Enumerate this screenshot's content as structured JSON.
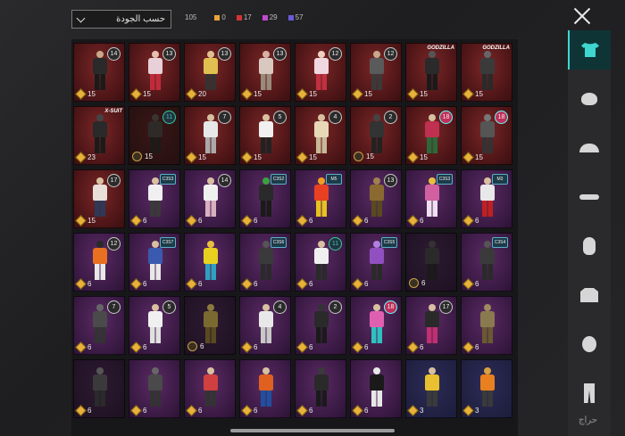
{
  "topbar": {
    "sort_label": "حسب الجودة",
    "total_count": "105",
    "rarity_counts": [
      {
        "color": "#e8a33a",
        "value": "0"
      },
      {
        "color": "#d23434",
        "value": "17"
      },
      {
        "color": "#c04ad0",
        "value": "29"
      },
      {
        "color": "#6a5ad8",
        "value": "57"
      }
    ]
  },
  "items": [
    {
      "bg": "red",
      "badge": "14",
      "badge_type": "circle",
      "qty_icon": "diamond",
      "qty": "15",
      "torso": "#2a2a2a",
      "legs": "#1a1a1a",
      "head": "#c9a88a"
    },
    {
      "bg": "red",
      "badge": "13",
      "badge_type": "circle",
      "qty_icon": "diamond",
      "qty": "15",
      "torso": "#e8d0d8",
      "legs": "#c02b3c",
      "head": "#e8c0b0"
    },
    {
      "bg": "red",
      "badge": "13",
      "badge_type": "circle",
      "qty_icon": "diamond",
      "qty": "20",
      "torso": "#e0c050",
      "legs": "#333",
      "head": "#e0c090"
    },
    {
      "bg": "red",
      "badge": "13",
      "badge_type": "circle",
      "qty_icon": "diamond",
      "qty": "15",
      "torso": "#d8c8c0",
      "legs": "#9a8a7a",
      "head": "#d8b0a0"
    },
    {
      "bg": "red",
      "badge": "12",
      "badge_type": "circle",
      "qty_icon": "diamond",
      "qty": "15",
      "torso": "#f0d8e0",
      "legs": "#c03040",
      "head": "#f0d0c0"
    },
    {
      "bg": "red",
      "badge": "12",
      "badge_type": "circle",
      "qty_icon": "diamond",
      "qty": "15",
      "torso": "#5a5a5a",
      "legs": "#3a3a3a",
      "head": "#c9a88a"
    },
    {
      "bg": "red",
      "banner": "GODZILLA",
      "badge_type": "banner",
      "qty_icon": "diamond",
      "qty": "15",
      "torso": "#2a2a2a",
      "legs": "#1a1a1a",
      "head": "#555"
    },
    {
      "bg": "red",
      "banner": "GODZILLA",
      "badge_type": "banner",
      "qty_icon": "diamond",
      "qty": "15",
      "torso": "#3a3a3a",
      "legs": "#2a2a2a",
      "head": "#666"
    },
    {
      "bg": "red",
      "banner": "X-SUIT",
      "badge_type": "banner",
      "qty_icon": "diamond",
      "qty": "23",
      "torso": "#2a2a2a",
      "legs": "#1a1a1a",
      "head": "#444"
    },
    {
      "bg": "darkred",
      "badge": "11",
      "badge_type": "green",
      "qty_icon": "coin",
      "qty": "15",
      "torso": "#2e2a28",
      "legs": "#1e1a18",
      "head": "#3a3430"
    },
    {
      "bg": "red",
      "badge": "7",
      "badge_type": "circle",
      "qty_icon": "diamond",
      "qty": "15",
      "torso": "#e8e8e8",
      "legs": "#aaa",
      "head": "#d8c0a0"
    },
    {
      "bg": "red",
      "badge": "5",
      "badge_type": "circle",
      "qty_icon": "diamond",
      "qty": "15",
      "torso": "#f0f0f0",
      "legs": "#222",
      "head": "#d8c0a0"
    },
    {
      "bg": "red",
      "badge": "4",
      "badge_type": "circle",
      "qty_icon": "diamond",
      "qty": "15",
      "torso": "#e8d8b8",
      "legs": "#c8b898",
      "head": "#d8c0a0"
    },
    {
      "bg": "red",
      "badge": "2",
      "badge_type": "circle",
      "qty_icon": "coin",
      "qty": "15",
      "torso": "#333",
      "legs": "#222",
      "head": "#444"
    },
    {
      "bg": "red",
      "badge": "18",
      "badge_type": "pink",
      "qty_icon": "diamond",
      "qty": "15",
      "torso": "#c03050",
      "legs": "#2a6a3a",
      "head": "#d8c0a0"
    },
    {
      "bg": "red",
      "badge": "18",
      "badge_type": "pink",
      "qty_icon": "diamond",
      "qty": "15",
      "torso": "#555",
      "legs": "#333",
      "head": "#777"
    },
    {
      "bg": "red",
      "badge": "17",
      "badge_type": "circle",
      "qty_icon": "diamond",
      "qty": "15",
      "torso": "#e8e0d8",
      "legs": "#2a3a5a",
      "head": "#d8c0a0"
    },
    {
      "bg": "purple",
      "badge": "C3S3",
      "badge_type": "tag",
      "qty_icon": "diamond",
      "qty": "6",
      "torso": "#f0f0f0",
      "legs": "#3a3a3a",
      "head": "#d8c0a0"
    },
    {
      "bg": "purple",
      "badge": "14",
      "badge_type": "circle",
      "qty_icon": "diamond",
      "qty": "6",
      "torso": "#f0f0f0",
      "legs": "#d8b0c0",
      "head": "#d8c0a0"
    },
    {
      "bg": "purple",
      "badge": "C3S2",
      "badge_type": "tag",
      "qty_icon": "diamond",
      "qty": "6",
      "torso": "#2a2a2a",
      "legs": "#1a1a1a",
      "head": "#3aa040"
    },
    {
      "bg": "purple",
      "badge": "M5",
      "badge_type": "tag",
      "qty_icon": "diamond",
      "qty": "6",
      "torso": "#e84020",
      "legs": "#e8c020",
      "head": "#f0a020"
    },
    {
      "bg": "purple",
      "badge": "13",
      "badge_type": "circle",
      "qty_icon": "diamond",
      "qty": "6",
      "torso": "#8a6a30",
      "legs": "#5a4a20",
      "head": "#a08050"
    },
    {
      "bg": "purple",
      "badge": "C3S3",
      "badge_type": "tag",
      "qty_icon": "diamond",
      "qty": "6",
      "torso": "#d060a0",
      "legs": "#f0e0f0",
      "head": "#e8c040"
    },
    {
      "bg": "purple",
      "badge": "M3",
      "badge_type": "tag",
      "qty_icon": "diamond",
      "qty": "6",
      "torso": "#e8e8e8",
      "legs": "#c02020",
      "head": "#d8c0a0"
    },
    {
      "bg": "purple",
      "badge": "12",
      "badge_type": "circle",
      "qty_icon": "diamond",
      "qty": "6",
      "torso": "#e87020",
      "legs": "#e8e8e8",
      "head": "#2a2a2a"
    },
    {
      "bg": "purple",
      "badge": "C3S7",
      "badge_type": "tag",
      "qty_icon": "diamond",
      "qty": "6",
      "torso": "#3a5ab0",
      "legs": "#e8e8e8",
      "head": "#d8c0a0"
    },
    {
      "bg": "purple",
      "badge": "",
      "badge_type": "none",
      "qty_icon": "diamond",
      "qty": "6",
      "torso": "#e8d020",
      "legs": "#30a0c0",
      "head": "#e8c040"
    },
    {
      "bg": "purple",
      "badge": "C3S6",
      "badge_type": "tag",
      "qty_icon": "diamond",
      "qty": "6",
      "torso": "#3a3a3a",
      "legs": "#2a2a2a",
      "head": "#555"
    },
    {
      "bg": "purple",
      "badge": "11",
      "badge_type": "green",
      "qty_icon": "diamond",
      "qty": "6",
      "torso": "#f0f0f0",
      "legs": "#2a2a2a",
      "head": "#d8c0a0"
    },
    {
      "bg": "purple",
      "badge": "C3S5",
      "badge_type": "tag",
      "qty_icon": "diamond",
      "qty": "6",
      "torso": "#9050c0",
      "legs": "#2a2a2a",
      "head": "#b080e0"
    },
    {
      "bg": "darkpurple",
      "badge": "",
      "badge_type": "none",
      "qty_icon": "coin",
      "qty": "6",
      "torso": "#2a2a2a",
      "legs": "#1a1a1a",
      "head": "#333"
    },
    {
      "bg": "purple",
      "badge": "C3S4",
      "badge_type": "tag",
      "qty_icon": "diamond",
      "qty": "6",
      "torso": "#3a3a3a",
      "legs": "#2a2a2a",
      "head": "#555"
    },
    {
      "bg": "purple",
      "badge": "7",
      "badge_type": "circle",
      "qty_icon": "diamond",
      "qty": "6",
      "torso": "#4a4a4a",
      "legs": "#333",
      "head": "#666"
    },
    {
      "bg": "purple",
      "badge": "5",
      "badge_type": "circle",
      "qty_icon": "diamond",
      "qty": "6",
      "torso": "#f0f0f0",
      "legs": "#e0e0e0",
      "head": "#d8c0a0"
    },
    {
      "bg": "darkpurple",
      "badge": "",
      "badge_type": "none",
      "qty_icon": "coin",
      "qty": "6",
      "torso": "#7a6a30",
      "legs": "#5a4a20",
      "head": "#8a7a40"
    },
    {
      "bg": "purple",
      "badge": "4",
      "badge_type": "circle",
      "qty_icon": "diamond",
      "qty": "6",
      "torso": "#e8e8e8",
      "legs": "#c8c8c8",
      "head": "#d8c0a0"
    },
    {
      "bg": "purple",
      "badge": "2",
      "badge_type": "circle",
      "qty_icon": "diamond",
      "qty": "6",
      "torso": "#2a2a2a",
      "legs": "#1a1a1a",
      "head": "#333"
    },
    {
      "bg": "purple",
      "badge": "18",
      "badge_type": "pink",
      "qty_icon": "diamond",
      "qty": "6",
      "torso": "#e060b0",
      "legs": "#30c0c0",
      "head": "#d8c0a0"
    },
    {
      "bg": "purple",
      "badge": "17",
      "badge_type": "circle",
      "qty_icon": "diamond",
      "qty": "6",
      "torso": "#2a2a2a",
      "legs": "#c03070",
      "head": "#d8c0a0"
    },
    {
      "bg": "purple",
      "badge": "",
      "badge_type": "none",
      "qty_icon": "diamond",
      "qty": "6",
      "torso": "#8a7a50",
      "legs": "#6a5a30",
      "head": "#a08a60"
    },
    {
      "bg": "darkpurple",
      "badge": "",
      "badge_type": "none",
      "qty_icon": "diamond",
      "qty": "6",
      "torso": "#3a3a3a",
      "legs": "#2a2a2a",
      "head": "#555"
    },
    {
      "bg": "purple",
      "badge": "",
      "badge_type": "none",
      "qty_icon": "diamond",
      "qty": "6",
      "torso": "#4a4a4a",
      "legs": "#333",
      "head": "#666"
    },
    {
      "bg": "purple",
      "badge": "",
      "badge_type": "none",
      "qty_icon": "diamond",
      "qty": "6",
      "torso": "#d04040",
      "legs": "#333",
      "head": "#d8c0a0"
    },
    {
      "bg": "purple",
      "badge": "",
      "badge_type": "none",
      "qty_icon": "diamond",
      "qty": "6",
      "torso": "#e06020",
      "legs": "#2050a0",
      "head": "#d8c0a0"
    },
    {
      "bg": "purple",
      "badge": "",
      "badge_type": "none",
      "qty_icon": "diamond",
      "qty": "6",
      "torso": "#2a2a2a",
      "legs": "#1a1a1a",
      "head": "#3a3a3a"
    },
    {
      "bg": "purple",
      "badge": "",
      "badge_type": "none",
      "qty_icon": "diamond",
      "qty": "6",
      "torso": "#1a1a1a",
      "legs": "#e8e8e8",
      "head": "#e8e8e8"
    },
    {
      "bg": "blue",
      "badge": "",
      "badge_type": "none",
      "qty_icon": "diamond",
      "qty": "3",
      "torso": "#e8c030",
      "legs": "#3a3a3a",
      "head": "#d8c0a0"
    },
    {
      "bg": "blue",
      "badge": "",
      "badge_type": "none",
      "qty_icon": "diamond",
      "qty": "3",
      "torso": "#e88020",
      "legs": "#3a3a3a",
      "head": "#d8a040"
    }
  ],
  "sidebar": {
    "categories": [
      {
        "name": "outfit-icon",
        "active": true
      },
      {
        "name": "mask-icon",
        "active": false
      },
      {
        "name": "cap-icon",
        "active": false
      },
      {
        "name": "glasses-icon",
        "active": false
      },
      {
        "name": "face-mask-icon",
        "active": false
      },
      {
        "name": "jacket-icon",
        "active": false
      },
      {
        "name": "head-icon",
        "active": false
      },
      {
        "name": "pants-icon",
        "active": false
      }
    ]
  },
  "watermark": "حراج"
}
